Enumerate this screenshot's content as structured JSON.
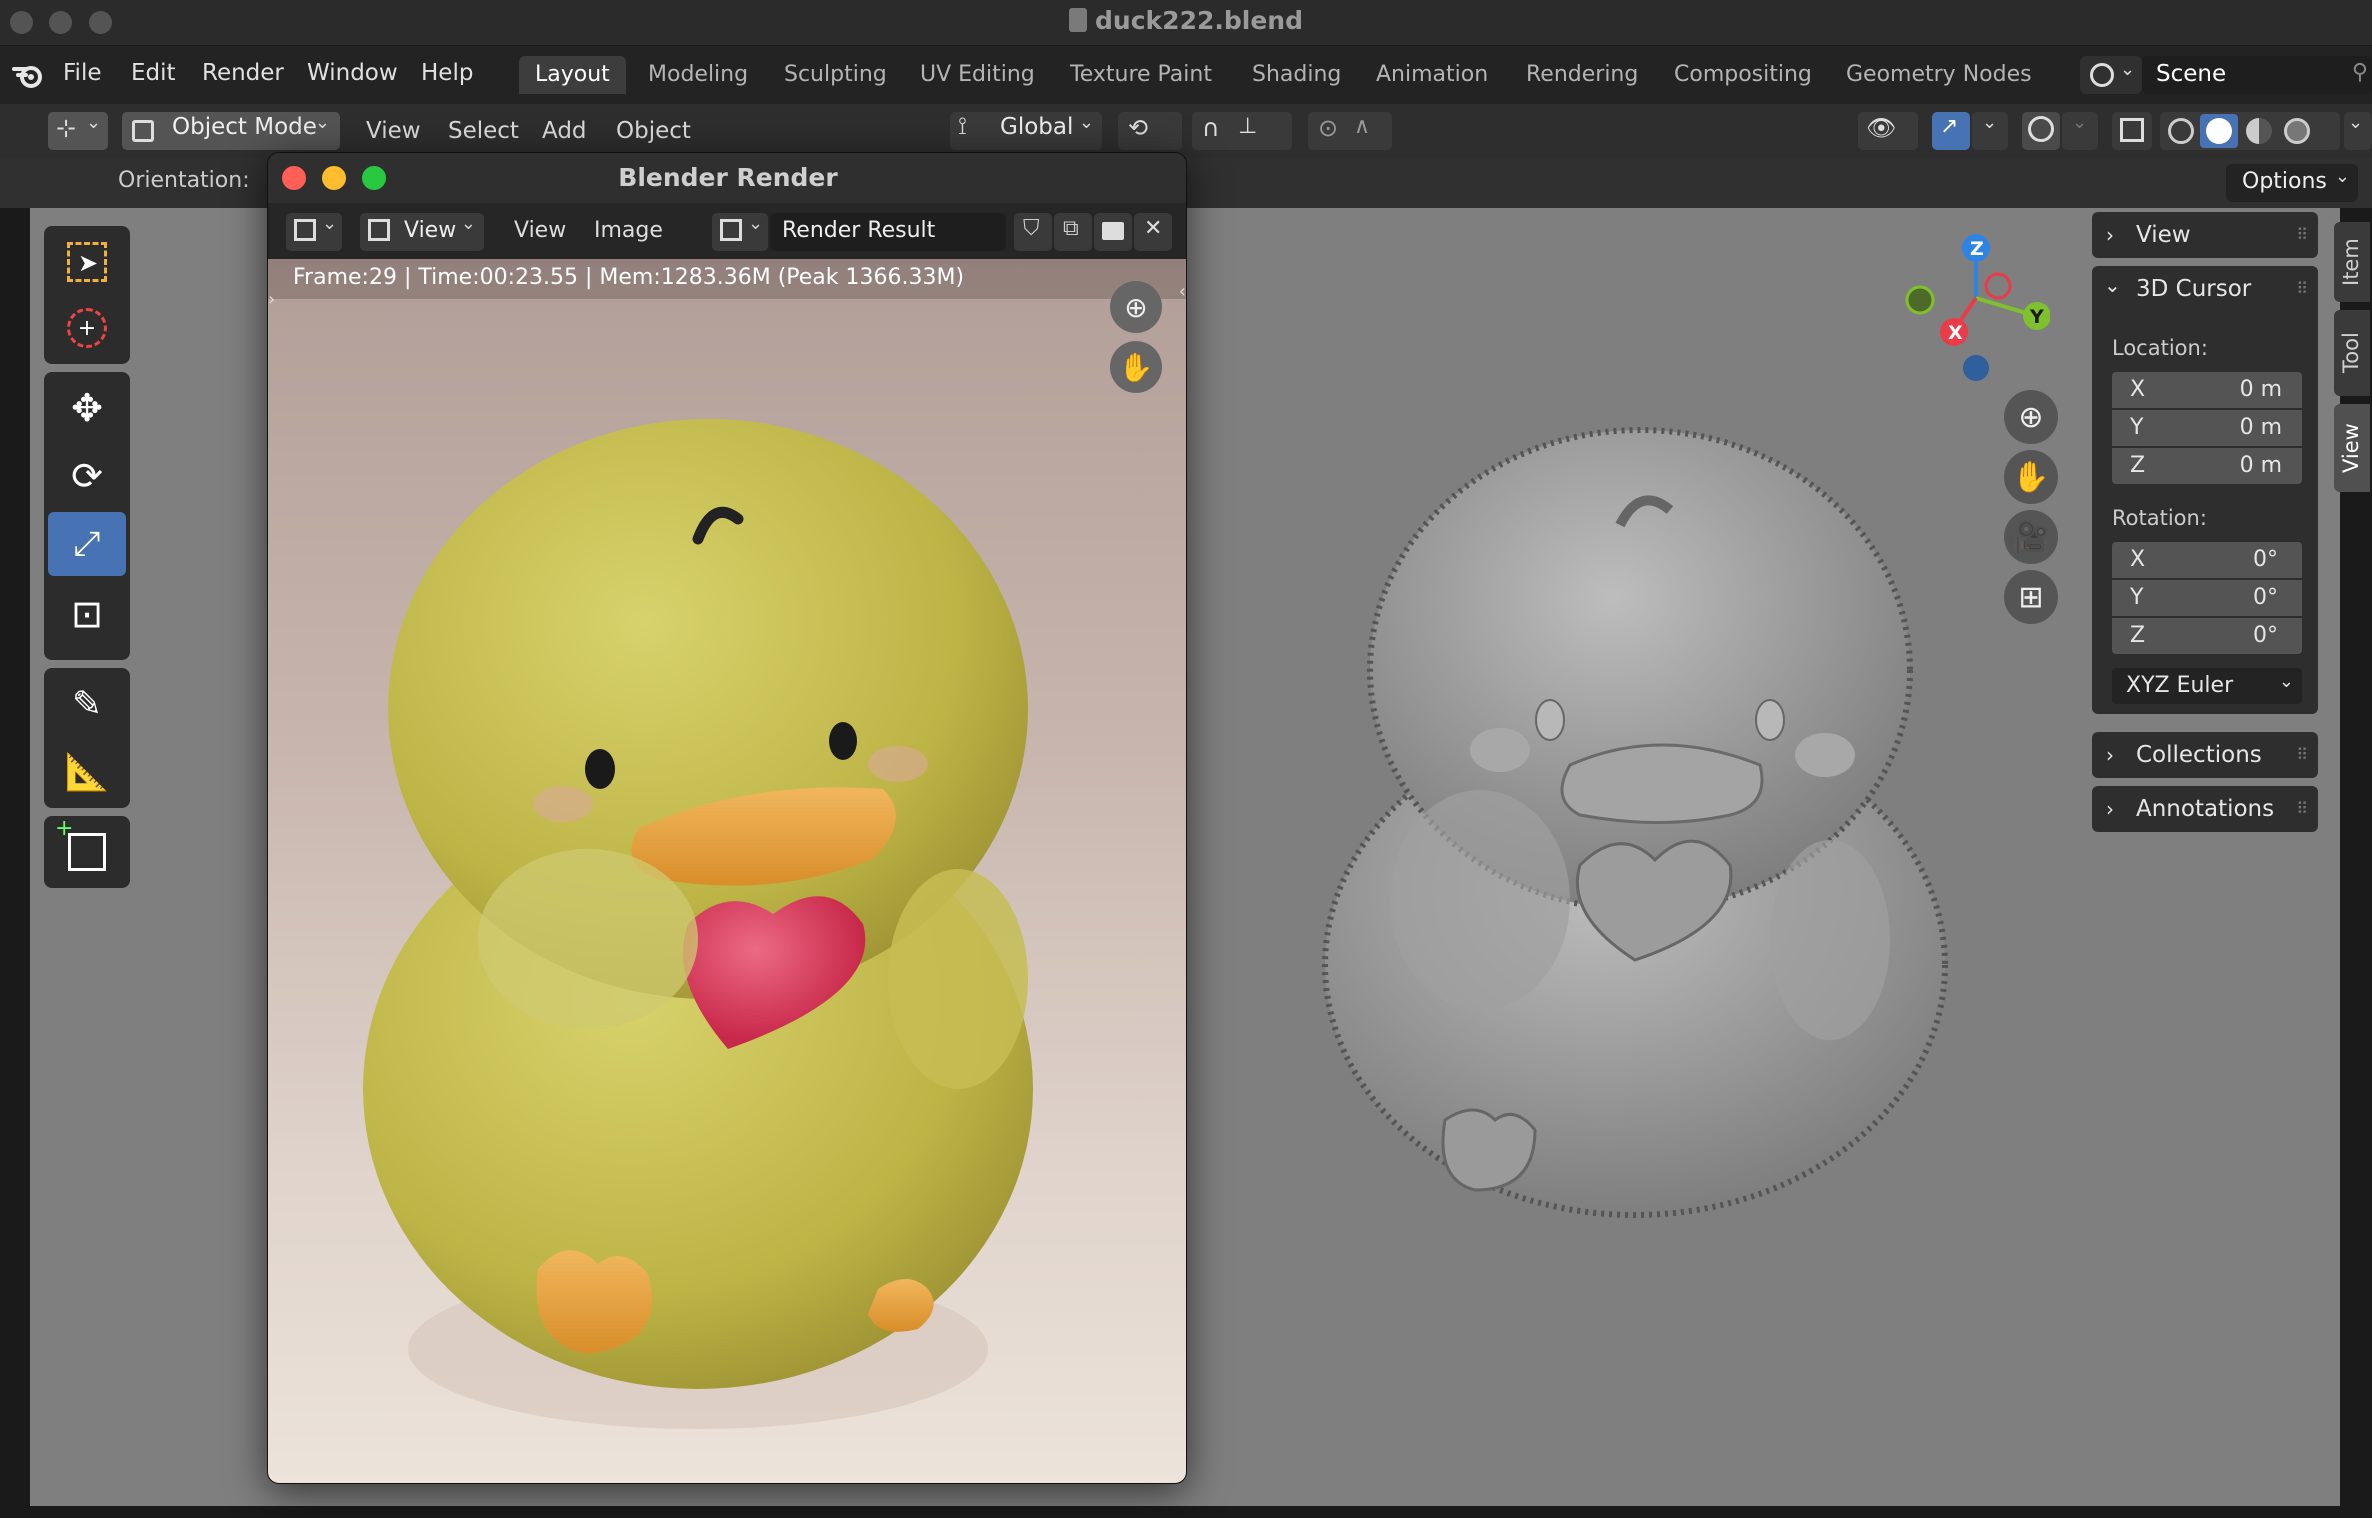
{
  "window": {
    "title": "duck222.blend"
  },
  "menu": {
    "items": [
      "File",
      "Edit",
      "Render",
      "Window",
      "Help"
    ]
  },
  "workspaces": [
    "Layout",
    "Modeling",
    "Sculpting",
    "UV Editing",
    "Texture Paint",
    "Shading",
    "Animation",
    "Rendering",
    "Compositing",
    "Geometry Nodes"
  ],
  "active_workspace": "Layout",
  "scene": {
    "name": "Scene"
  },
  "header": {
    "mode": "Object Mode",
    "view": "View",
    "select": "Select",
    "add": "Add",
    "object": "Object",
    "transform": "Global",
    "orientation_label": "Orientation:",
    "options": "Options"
  },
  "render_window": {
    "title": "Blender Render",
    "view1": "View",
    "view2": "View",
    "image": "Image",
    "result": "Render Result",
    "info": "Frame:29 | Time:00:23.55 | Mem:1283.36M (Peak 1366.33M)"
  },
  "gizmo": {
    "x": "X",
    "y": "Y",
    "z": "Z"
  },
  "npanel": {
    "view": "View",
    "cursor": "3D Cursor",
    "location_label": "Location:",
    "location": [
      {
        "axis": "X",
        "value": "0 m"
      },
      {
        "axis": "Y",
        "value": "0 m"
      },
      {
        "axis": "Z",
        "value": "0 m"
      }
    ],
    "rotation_label": "Rotation:",
    "rotation": [
      {
        "axis": "X",
        "value": "0°"
      },
      {
        "axis": "Y",
        "value": "0°"
      },
      {
        "axis": "Z",
        "value": "0°"
      }
    ],
    "rotation_mode": "XYZ Euler",
    "collections": "Collections",
    "annotations": "Annotations"
  },
  "tabs": [
    "Item",
    "Tool",
    "View"
  ],
  "active_tab": "View",
  "colors": {
    "accent": "#4772b3",
    "axis_x": "#e93b48",
    "axis_y": "#7ec12c",
    "axis_z": "#2f84e3"
  }
}
